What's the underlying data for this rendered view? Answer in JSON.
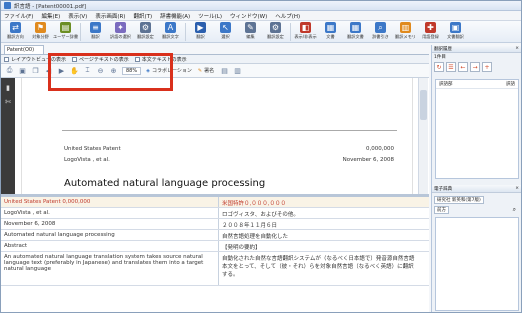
{
  "window": {
    "title": "訳言語 - [Patent00001.pdf]"
  },
  "menu": {
    "items": [
      "ファイル(F)",
      "編集(E)",
      "表示(V)",
      "表示画面(R)",
      "翻訳(T)",
      "辞書機能(A)",
      "ツール(L)",
      "ウィンドウ(W)",
      "ヘルプ(H)"
    ]
  },
  "toolbar": {
    "buttons": [
      {
        "label": "翻訳方向",
        "icon": "translate-direction-icon",
        "color": "#3c78c8"
      },
      {
        "label": "対象分野",
        "icon": "field-icon",
        "color": "#e08a1e"
      },
      {
        "label": "ユーザー辞書",
        "icon": "user-dictionary-icon",
        "color": "#6b8e23"
      },
      {
        "label": "翻訳",
        "icon": "translate-icon",
        "color": "#3c78c8"
      },
      {
        "label": "訳語の選択",
        "icon": "word-select-icon",
        "color": "#7a6bbf"
      },
      {
        "label": "翻訳設定",
        "icon": "settings-icon",
        "color": "#5d7394"
      },
      {
        "label": "翻訳文字",
        "icon": "text-icon",
        "color": "#3c78c8"
      },
      {
        "label": "翻訳",
        "icon": "run-translate-icon",
        "color": "#2b5fae"
      },
      {
        "label": "選択",
        "icon": "select-icon",
        "color": "#3c78c8"
      },
      {
        "label": "編集",
        "icon": "edit-icon",
        "color": "#5d7394"
      },
      {
        "label": "翻訳設定",
        "icon": "config-icon",
        "color": "#5d7394"
      },
      {
        "label": "表示/非表示",
        "icon": "toggle-view-icon",
        "color": "#c0392b"
      },
      {
        "label": "文書",
        "icon": "document-icon",
        "color": "#3c78c8"
      },
      {
        "label": "翻訳文書",
        "icon": "translated-document-icon",
        "color": "#3c78c8"
      },
      {
        "label": "辞書引き",
        "icon": "lookup-icon",
        "color": "#3c78c8"
      },
      {
        "label": "翻訳メモリ",
        "icon": "memory-icon",
        "color": "#e08a1e"
      },
      {
        "label": "用語登録",
        "icon": "register-term-icon",
        "color": "#c0392b"
      },
      {
        "label": "文書翻訳",
        "icon": "batch-translate-icon",
        "color": "#3c78c8"
      }
    ]
  },
  "document_tab": {
    "label": "Patent(O0)"
  },
  "view_tabs": {
    "layout_label": "レイアウトビューの表示",
    "page_text_label": "ページテキストの表示",
    "body_text_label": "本文テキストの表示"
  },
  "view_tools": {
    "zoom": "88%",
    "collaboration_label": "コラボレーション",
    "annotation_label": "署名"
  },
  "pdf": {
    "header_left": "United States Patent",
    "header_right": "0,000,000",
    "sub_left": "LogoVista , et al.",
    "sub_right": "November 6, 2008",
    "title": "Automated natural language processing"
  },
  "table": {
    "rows": [
      {
        "en": "United States Patent 0,000,000",
        "ja": "米国特許０,０００,０００",
        "selected": true
      },
      {
        "en": "LogoVista , et al.",
        "ja": "ロゴヴィスタ、およびその他。",
        "selected": false
      },
      {
        "en": "November 6, 2008",
        "ja": "２００８年１１月６日",
        "selected": false
      },
      {
        "en": "Automated natural language processing",
        "ja": "自然言語処理を自動化した",
        "selected": false
      },
      {
        "en": "Abstract",
        "ja": "【発明の要約】",
        "selected": false
      },
      {
        "en": "An automated natural language translation system takes source natural language text (preferably in Japanese) and translates them into a target natural language",
        "ja": "自動化された自然な言語翻訳システムが（なるべく日本語で）発音源自然言語本文をとって、そして（彼・それ）らを対象自然言語（なるべく英語）に翻訳する。",
        "selected": false
      }
    ]
  },
  "right_pane": {
    "header": "翻訳履歴",
    "subheader": "1件目",
    "col_original": "訳語部",
    "col_translation": "訳語",
    "dictionary_header": "電子辞典",
    "dictionary_select": "研究社 新英和(第7版)",
    "dictionary_mode": "前方"
  }
}
